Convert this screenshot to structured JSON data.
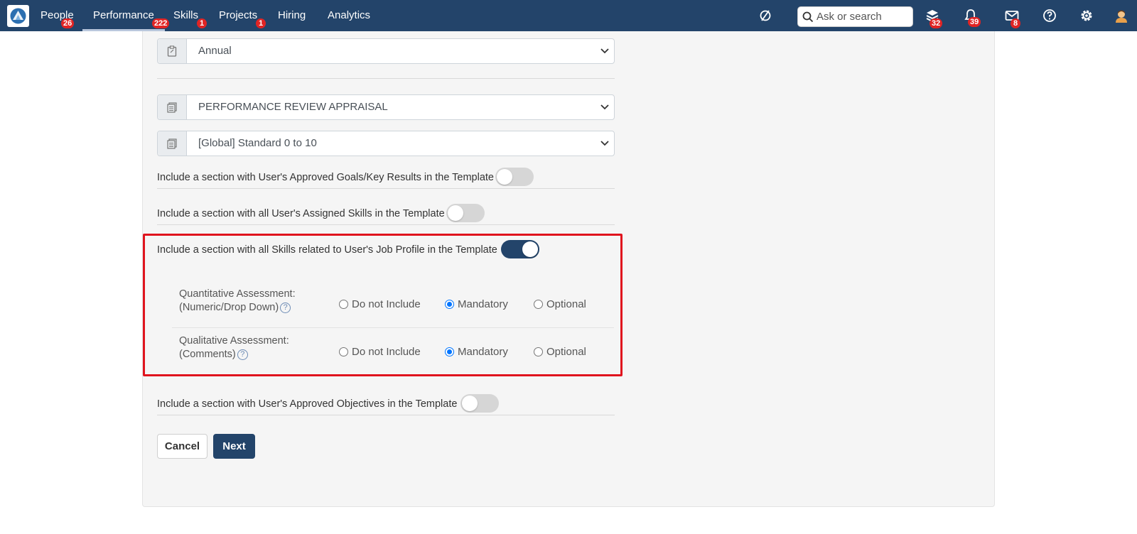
{
  "nav": {
    "items": [
      {
        "label": "People",
        "badge": "26"
      },
      {
        "label": "Performance",
        "badge": "222"
      },
      {
        "label": "Skills",
        "badge": "1"
      },
      {
        "label": "Projects",
        "badge": "1"
      },
      {
        "label": "Hiring",
        "badge": ""
      },
      {
        "label": "Analytics",
        "badge": ""
      }
    ],
    "search_placeholder": "Ask or search",
    "icons": {
      "timer_icon": "slashed-circle-icon",
      "tasks_badge": "32",
      "notifications_badge": "39",
      "messages_badge": "8"
    }
  },
  "form": {
    "frequency_value": "Annual",
    "template_value": "PERFORMANCE REVIEW APPRAISAL",
    "rating_scale_value": "[Global] Standard 0 to 10",
    "toggles": [
      {
        "label": "Include a section with User's Approved Goals/Key Results in the Template",
        "on": false
      },
      {
        "label": "Include a section with all User's Assigned Skills in the Template",
        "on": false
      },
      {
        "label": "Include a section with all Skills related to User's Job Profile in the Template",
        "on": true
      },
      {
        "label": "Include a section with User's Approved Objectives in the Template",
        "on": false
      }
    ],
    "assessments": [
      {
        "line1": "Quantitative Assessment:",
        "line2": "(Numeric/Drop Down)",
        "selected": "Mandatory"
      },
      {
        "line1": "Qualitative Assessment:",
        "line2": "(Comments)",
        "selected": "Mandatory"
      }
    ],
    "options": [
      "Do not Include",
      "Mandatory",
      "Optional"
    ],
    "cancel_label": "Cancel",
    "next_label": "Next"
  },
  "colors": {
    "navbar": "#23446a",
    "highlight": "#e0141e",
    "badge": "#e02424",
    "toggle_on": "#23446a"
  }
}
